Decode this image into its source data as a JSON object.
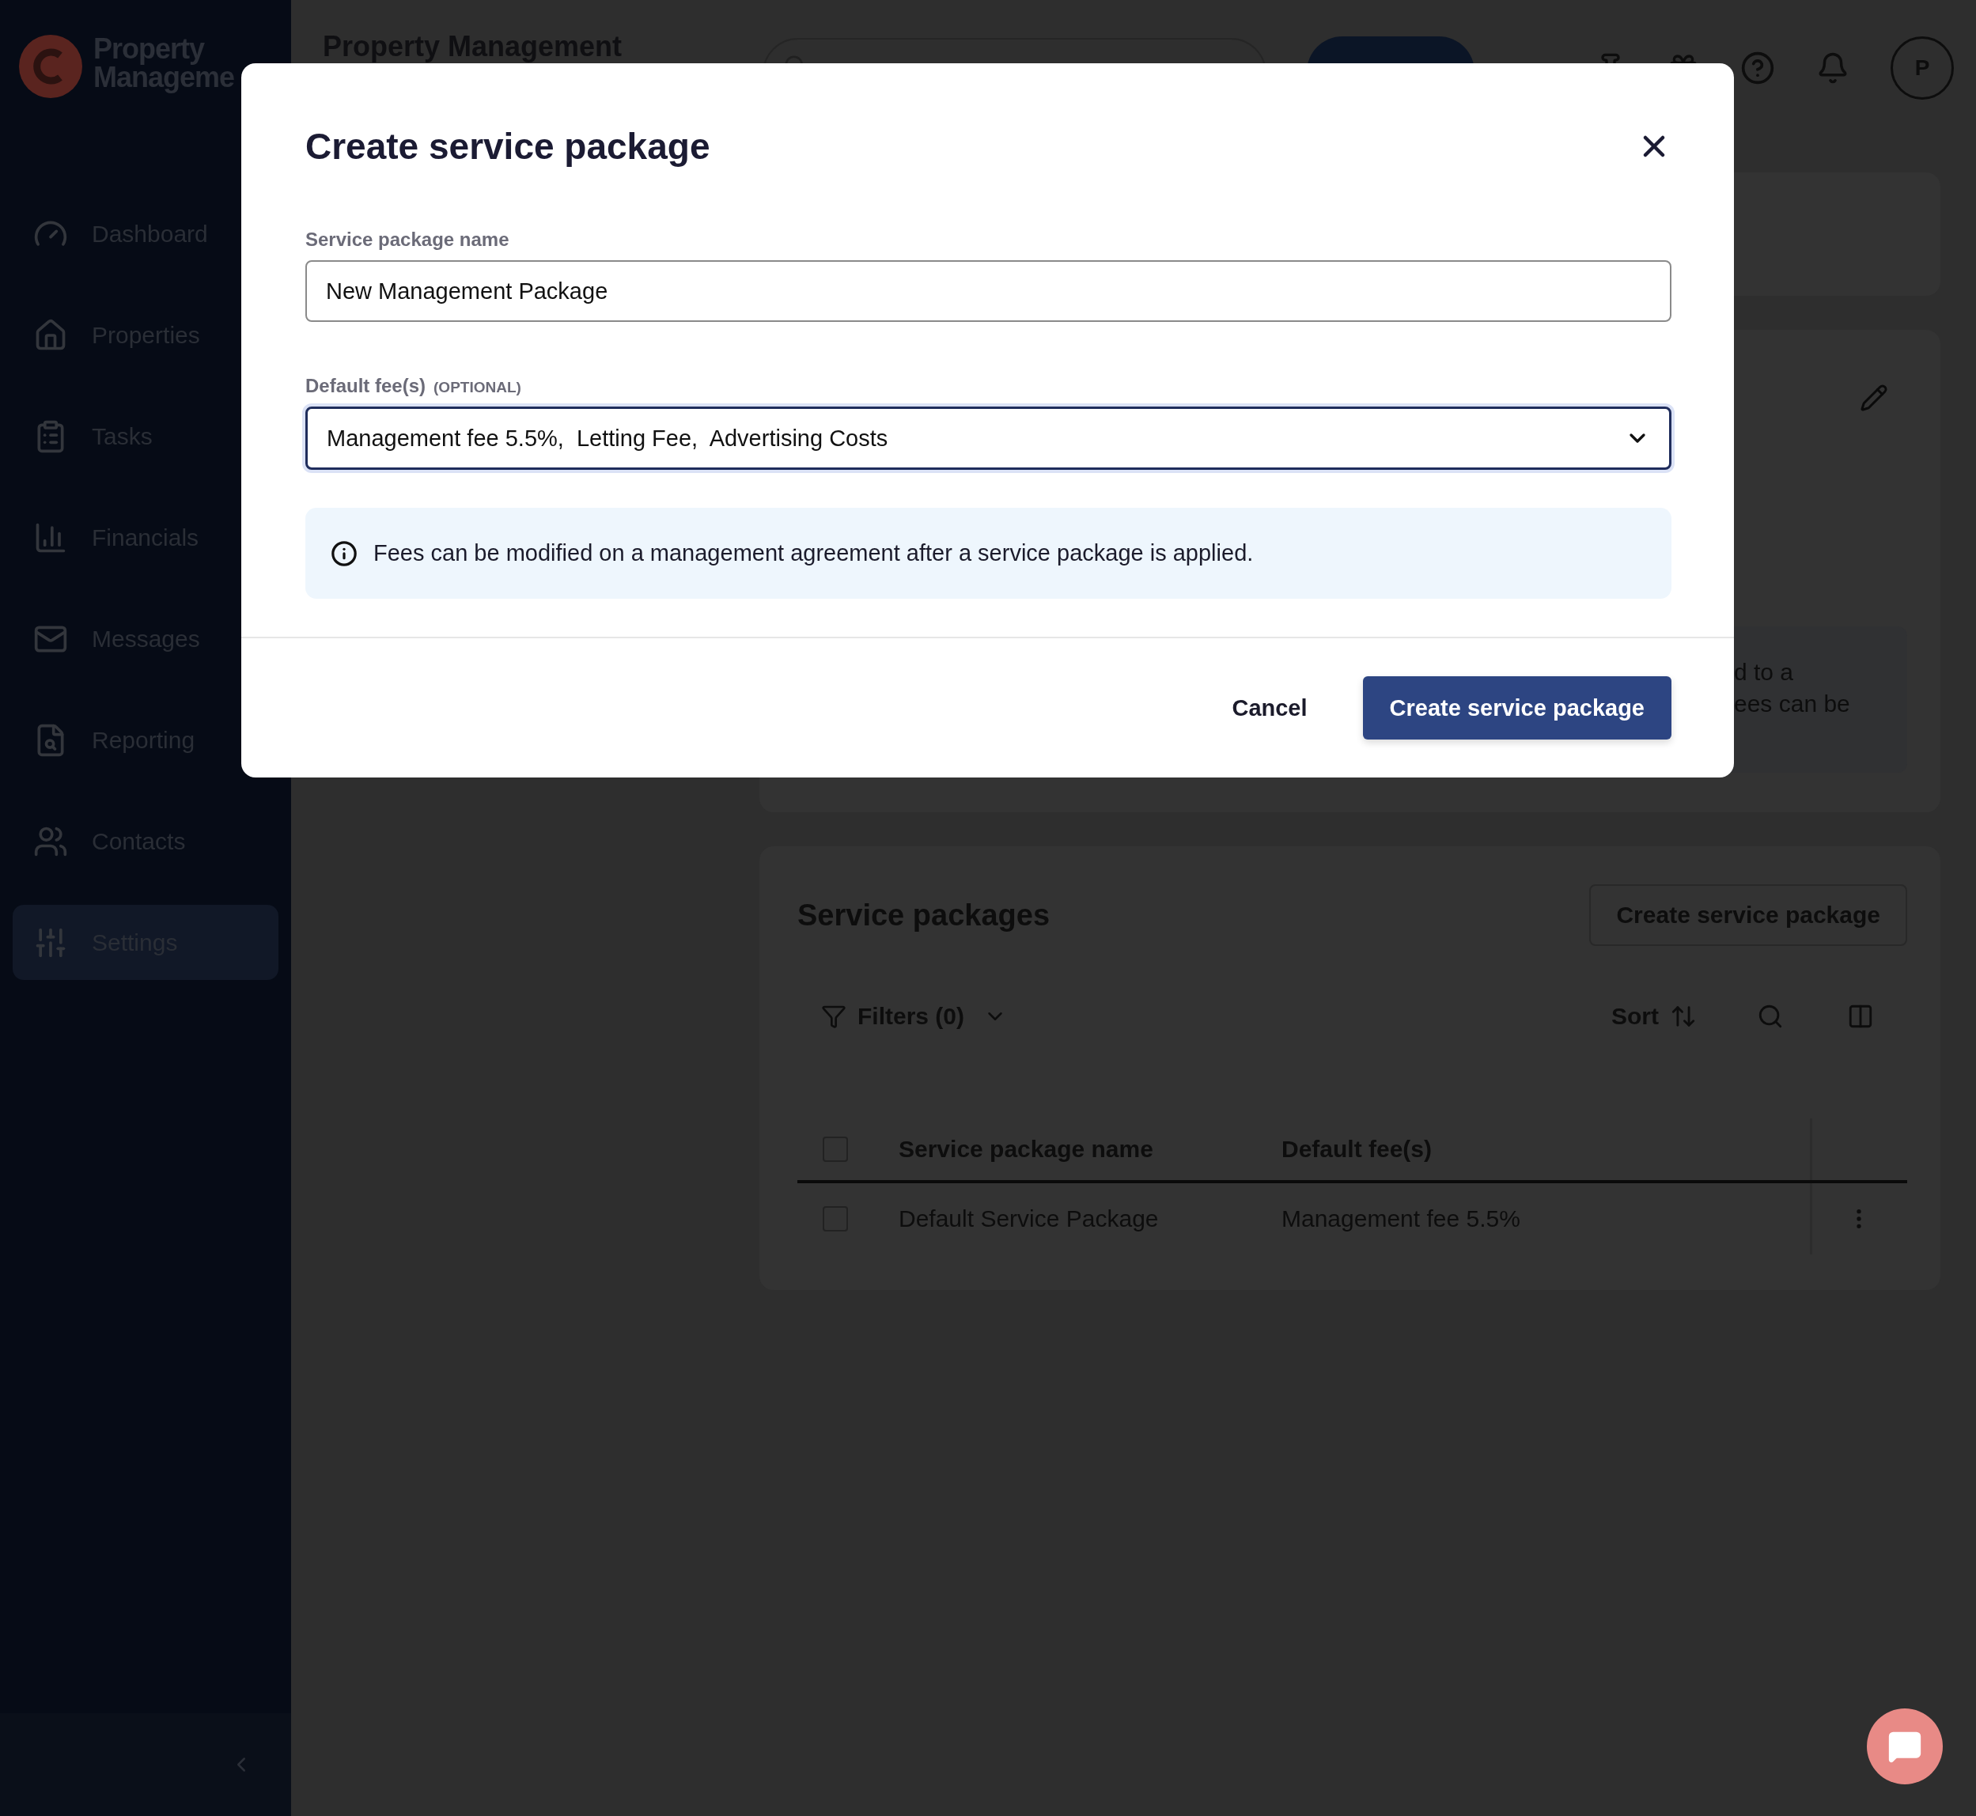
{
  "sidebar": {
    "logo_text": [
      "Property",
      "Manageme"
    ],
    "items": [
      {
        "label": "Dashboard",
        "selected": false
      },
      {
        "label": "Properties",
        "selected": false
      },
      {
        "label": "Tasks",
        "selected": false
      },
      {
        "label": "Financials",
        "selected": false
      },
      {
        "label": "Messages",
        "selected": false
      },
      {
        "label": "Reporting",
        "selected": false
      },
      {
        "label": "Contacts",
        "selected": false
      },
      {
        "label": "Settings",
        "selected": true
      }
    ]
  },
  "header": {
    "title": "Property Management",
    "avatar": "P"
  },
  "agreement_card": {
    "text_lines": [
      "d to a",
      "ees can be"
    ]
  },
  "service_packages": {
    "title": "Service packages",
    "create_button": "Create service package",
    "filters": "Filters (0)",
    "sort": "Sort",
    "table": {
      "columns": [
        "Service package name",
        "Default fee(s)"
      ],
      "all_checked": false,
      "rows": [
        {
          "name": "Default Service Package",
          "fees": "Management fee 5.5%",
          "checked": false
        }
      ]
    }
  },
  "modal": {
    "title": "Create service package",
    "fields": [
      {
        "kind": "text",
        "label": "Service package name",
        "value": "New Management Package",
        "focused": false
      },
      {
        "kind": "select",
        "label": "Default fee(s)",
        "tag": "(OPTIONAL)",
        "value": "Management fee 5.5%,  Letting Fee,  Advertising Costs",
        "focused": true
      }
    ],
    "info": "Fees can be modified on a management agreement after a service package is applied.",
    "buttons": [
      {
        "kind": "secondary",
        "label": "Cancel"
      },
      {
        "kind": "primary",
        "label": "Create service package"
      }
    ]
  }
}
